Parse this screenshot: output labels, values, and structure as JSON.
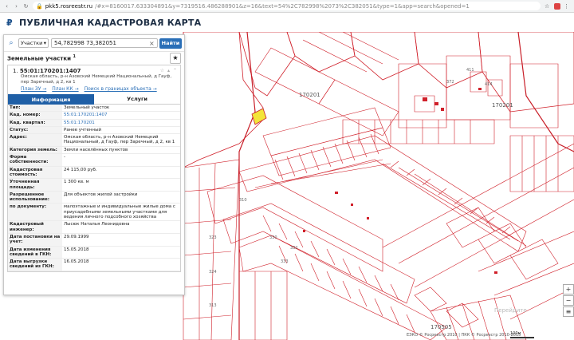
{
  "browser": {
    "host": "pkk5.rosreestr.ru",
    "path": "/#x=8160017.633304891&y=7319516.486288901&z=16&text=54%2C782998%2073%2C382051&type=1&app=search&opened=1"
  },
  "app": {
    "title": "ПУБЛИЧНАЯ КАДАСТРОВАЯ КАРТА"
  },
  "search": {
    "type_label": "Участки",
    "query": "54,782998 73,382051",
    "button": "Найти"
  },
  "panel": {
    "section_title": "Земельные участки",
    "count": "1",
    "item_index": "1.",
    "cad_number": "55:01:170201:1407",
    "address": "Омская область, р-н Азовский Немецкий Национальный, д Гауф, пер Заречный, д 2, кв 1",
    "links": [
      "План ЗУ →",
      "План КК →",
      "Поиск в границах объекта →"
    ],
    "tabs": [
      "Информация",
      "Услуги"
    ],
    "props": [
      {
        "k": "Тип:",
        "v": "Земельный участок"
      },
      {
        "k": "Кад. номер:",
        "v": "55:01:170201:1407",
        "link": true
      },
      {
        "k": "Кад. квартал:",
        "v": "55:01:170201",
        "link": true
      },
      {
        "k": "Статус:",
        "v": "Ранее учтенный"
      },
      {
        "k": "Адрес:",
        "v": "Омская область, р-н Азовский Немецкий Национальный, д Гауф, пер Заречный, д 2, кв 1"
      },
      {
        "k": "Категория земель:",
        "v": "Земли населённых пунктов"
      },
      {
        "k": "Форма собственности:",
        "v": "-"
      },
      {
        "k": "Кадастровая стоимость:",
        "v": "24 115,00 руб."
      },
      {
        "k": "Уточненная площадь:",
        "v": "1 300 кв. м"
      },
      {
        "k": "Разрешенное использование:",
        "v": "Для объектов жилой застройки"
      },
      {
        "k": "по документу:",
        "v": "малоэтажные и индивидуальные жилые дома с приусадебными земельными участками для ведения личного подсобного хозяйства"
      },
      {
        "k": "Кадастровый инженер:",
        "v": "Лысюк Наталья Леонидовна"
      },
      {
        "k": "Дата постановки на учет:",
        "v": "29.09.1999"
      },
      {
        "k": "Дата изменения сведений в ГКН:",
        "v": "15.05.2018"
      },
      {
        "k": "Дата выгрузки сведений из ГКН:",
        "v": "16.05.2018"
      }
    ]
  },
  "map": {
    "labels": [
      "170201",
      "170201",
      "170505",
      "372",
      "411",
      "414",
      "333",
      "332",
      "330",
      "310",
      "323",
      "324",
      "313"
    ],
    "attribution": "ЕЭКО © Росреестр 2010 | ПКК © Росреестр 2010-2015",
    "scale": "100м",
    "watermark": "Перейдите"
  },
  "colors": {
    "parcel": "#d0202a",
    "accent": "#2a6fb7",
    "highlight": "#f3e53a"
  }
}
